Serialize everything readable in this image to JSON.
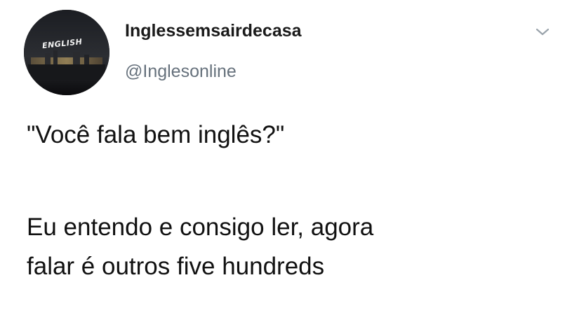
{
  "tweet": {
    "avatar": {
      "label": "ENGLISH",
      "icon": "profile-avatar"
    },
    "display_name": "Inglessemsairdecasa",
    "handle": "@Inglesonline",
    "menu_icon": "chevron-down-icon",
    "text_lines": [
      "\"Você fala bem inglês?\"",
      "Eu entendo e consigo ler, agora",
      "falar é outros five hundreds"
    ]
  },
  "colors": {
    "background": "#ffffff",
    "name_text": "#1a1a1a",
    "handle_text": "#66717c",
    "body_text": "#111111",
    "caret": "#9aa3ab"
  }
}
